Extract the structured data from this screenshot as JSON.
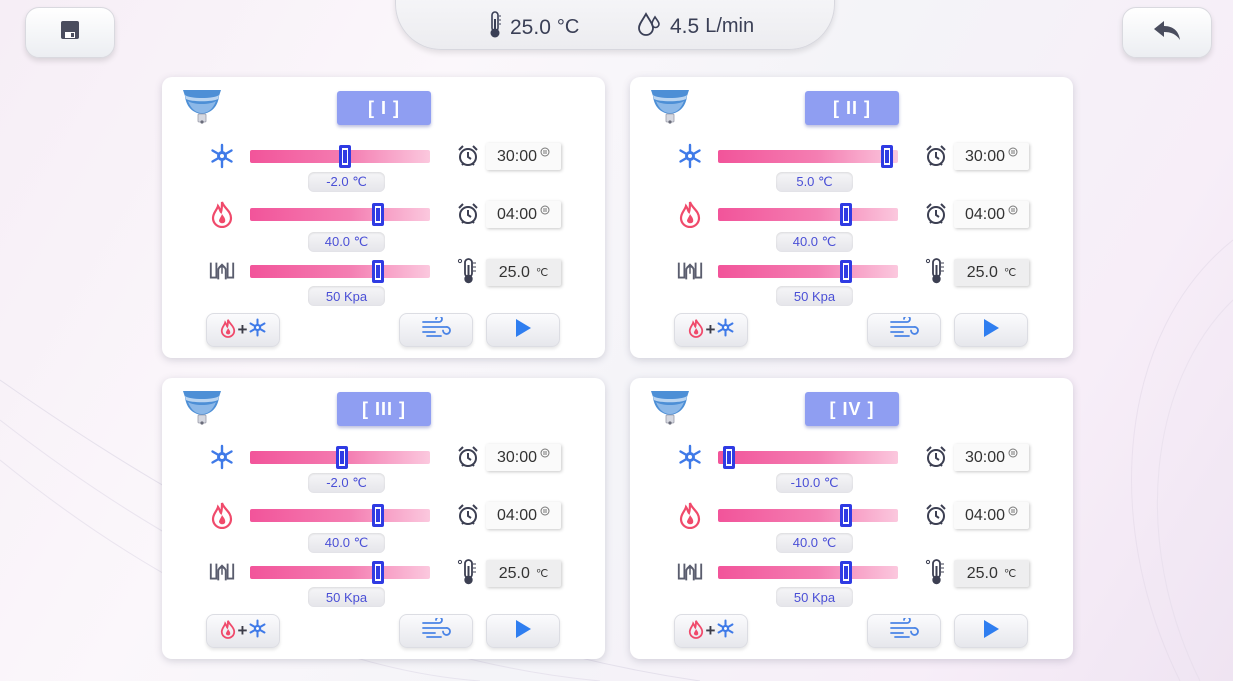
{
  "status": {
    "temperature": "25.0",
    "temperature_unit": "°C",
    "flow": "4.5",
    "flow_unit": "L/min"
  },
  "header_icons": {
    "save": "save-icon",
    "back": "back-arrow-icon",
    "thermometer": "thermometer-icon",
    "flow": "water-drop-icon"
  },
  "colors": {
    "accent": "#8f9ef2",
    "slider_start": "#f2549a",
    "slider_end": "#fbc8de",
    "thumb": "#2f3be3",
    "value_text": "#4a4fd6",
    "flame": "#f04a6b",
    "snow": "#3f7ae8"
  },
  "channels": [
    {
      "label": "[ I ]",
      "cool": {
        "value": "-2.0 ℃",
        "level": 0.53,
        "time": "30:00"
      },
      "heat": {
        "value": "40.0 ℃",
        "level": 0.71,
        "time": "04:00"
      },
      "pressure": {
        "value": "50 Kpa",
        "level": 0.71,
        "temp": "25.0",
        "temp_unit": "℃"
      }
    },
    {
      "label": "[ II ]",
      "cool": {
        "value": "5.0 ℃",
        "level": 0.94,
        "time": "30:00"
      },
      "heat": {
        "value": "40.0 ℃",
        "level": 0.71,
        "time": "04:00"
      },
      "pressure": {
        "value": "50 Kpa",
        "level": 0.71,
        "temp": "25.0",
        "temp_unit": "℃"
      }
    },
    {
      "label": "[ III ]",
      "cool": {
        "value": "-2.0 ℃",
        "level": 0.51,
        "time": "30:00"
      },
      "heat": {
        "value": "40.0 ℃",
        "level": 0.71,
        "time": "04:00"
      },
      "pressure": {
        "value": "50 Kpa",
        "level": 0.71,
        "temp": "25.0",
        "temp_unit": "℃"
      }
    },
    {
      "label": "[ IV ]",
      "cool": {
        "value": "-10.0 ℃",
        "level": 0.06,
        "time": "30:00"
      },
      "heat": {
        "value": "40.0 ℃",
        "level": 0.71,
        "time": "04:00"
      },
      "pressure": {
        "value": "50 Kpa",
        "level": 0.71,
        "temp": "25.0",
        "temp_unit": "℃"
      }
    }
  ]
}
